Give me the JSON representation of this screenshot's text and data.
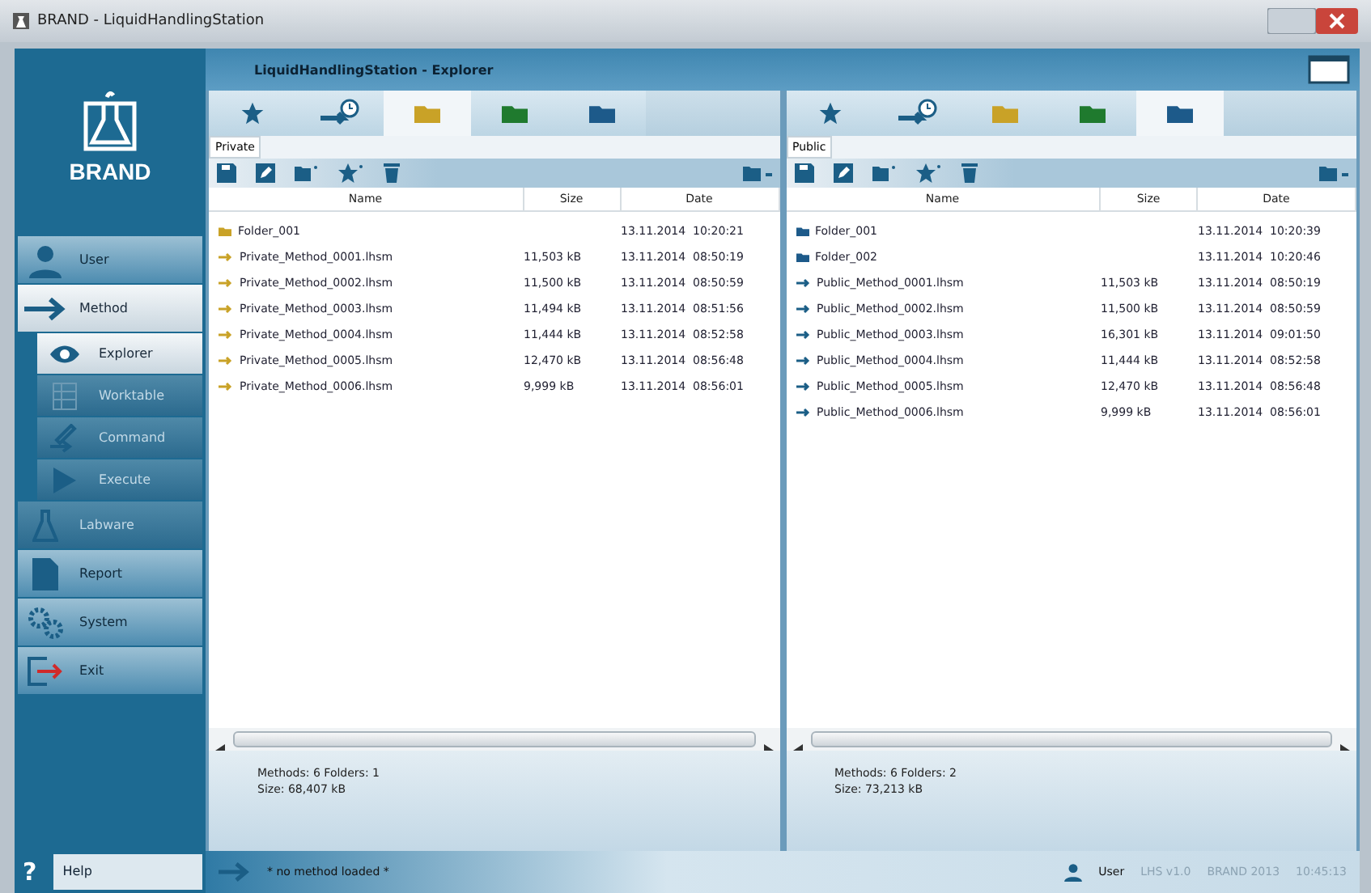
{
  "window": {
    "title": "BRAND - LiquidHandlingStation"
  },
  "logo": {
    "text": "BRAND"
  },
  "header": {
    "title": "LiquidHandlingStation - Explorer"
  },
  "nav": [
    {
      "label": "User",
      "kind": "user",
      "sub": false,
      "selected": false,
      "disabled": false
    },
    {
      "label": "Method",
      "kind": "method",
      "sub": false,
      "selected": true,
      "disabled": false
    },
    {
      "label": "Explorer",
      "kind": "eye",
      "sub": true,
      "selected": true,
      "disabled": false
    },
    {
      "label": "Worktable",
      "kind": "grid",
      "sub": true,
      "selected": false,
      "disabled": true
    },
    {
      "label": "Command",
      "kind": "pen",
      "sub": true,
      "selected": false,
      "disabled": true
    },
    {
      "label": "Execute",
      "kind": "play",
      "sub": true,
      "selected": false,
      "disabled": true
    },
    {
      "label": "Labware",
      "kind": "flask",
      "sub": false,
      "selected": false,
      "disabled": true
    },
    {
      "label": "Report",
      "kind": "doc",
      "sub": false,
      "selected": false,
      "disabled": false
    },
    {
      "label": "System",
      "kind": "gears",
      "sub": false,
      "selected": false,
      "disabled": false
    },
    {
      "label": "Exit",
      "kind": "exit",
      "sub": false,
      "selected": false,
      "disabled": false
    }
  ],
  "panels": [
    {
      "tabs": [
        {
          "kind": "star",
          "selected": false
        },
        {
          "kind": "recent",
          "selected": false
        },
        {
          "kind": "folder",
          "color": "#c9a227",
          "selected": true
        },
        {
          "kind": "folder",
          "color": "#1f7a2e",
          "selected": false
        },
        {
          "kind": "folder",
          "color": "#1d5a8a",
          "selected": false
        }
      ],
      "location": "Private",
      "columns": [
        "Name",
        "Size",
        "Date"
      ],
      "rows": [
        {
          "kind": "folder",
          "name": "Folder_001",
          "date": "13.11.2014  10:20:21"
        },
        {
          "kind": "method",
          "name": "Private_Method_0001.lhsm",
          "size": "11,503 kB",
          "date": "13.11.2014  08:50:19"
        },
        {
          "kind": "method",
          "name": "Private_Method_0002.lhsm",
          "size": "11,500 kB",
          "date": "13.11.2014  08:50:59"
        },
        {
          "kind": "method",
          "name": "Private_Method_0003.lhsm",
          "size": "11,494 kB",
          "date": "13.11.2014  08:51:56"
        },
        {
          "kind": "method",
          "name": "Private_Method_0004.lhsm",
          "size": "11,444 kB",
          "date": "13.11.2014  08:52:58"
        },
        {
          "kind": "method",
          "name": "Private_Method_0005.lhsm",
          "size": "12,470 kB",
          "date": "13.11.2014  08:56:48"
        },
        {
          "kind": "method",
          "name": "Private_Method_0006.lhsm",
          "size": "9,999 kB",
          "date": "13.11.2014  08:56:01"
        }
      ],
      "summary": [
        "Methods: 6 Folders: 1",
        "Size: 68,407 kB"
      ]
    },
    {
      "tabs": [
        {
          "kind": "star",
          "selected": false
        },
        {
          "kind": "recent",
          "selected": false
        },
        {
          "kind": "folder",
          "color": "#c9a227",
          "selected": false
        },
        {
          "kind": "folder",
          "color": "#1f7a2e",
          "selected": false
        },
        {
          "kind": "folder",
          "color": "#1d5a8a",
          "selected": true
        }
      ],
      "location": "Public",
      "columns": [
        "Name",
        "Size",
        "Date"
      ],
      "rows": [
        {
          "kind": "folder",
          "name": "Folder_001",
          "date": "13.11.2014  10:20:39"
        },
        {
          "kind": "folder",
          "name": "Folder_002",
          "date": "13.11.2014  10:20:46"
        },
        {
          "kind": "method",
          "name": "Public_Method_0001.lhsm",
          "size": "11,503 kB",
          "date": "13.11.2014  08:50:19"
        },
        {
          "kind": "method",
          "name": "Public_Method_0002.lhsm",
          "size": "11,500 kB",
          "date": "13.11.2014  08:50:59"
        },
        {
          "kind": "method",
          "name": "Public_Method_0003.lhsm",
          "size": "16,301 kB",
          "date": "13.11.2014  09:01:50"
        },
        {
          "kind": "method",
          "name": "Public_Method_0004.lhsm",
          "size": "11,444 kB",
          "date": "13.11.2014  08:52:58"
        },
        {
          "kind": "method",
          "name": "Public_Method_0005.lhsm",
          "size": "12,470 kB",
          "date": "13.11.2014  08:56:48"
        },
        {
          "kind": "method",
          "name": "Public_Method_0006.lhsm",
          "size": "9,999 kB",
          "date": "13.11.2014  08:56:01"
        }
      ],
      "summary": [
        "Methods: 6 Folders: 2",
        "Size: 73,213 kB"
      ]
    }
  ],
  "help": {
    "icon": "?",
    "label": "Help"
  },
  "status": {
    "method": "* no method loaded *",
    "user": "User",
    "version": "LHS v1.0",
    "copyright": "BRAND 2013",
    "time": "10:45:13"
  }
}
